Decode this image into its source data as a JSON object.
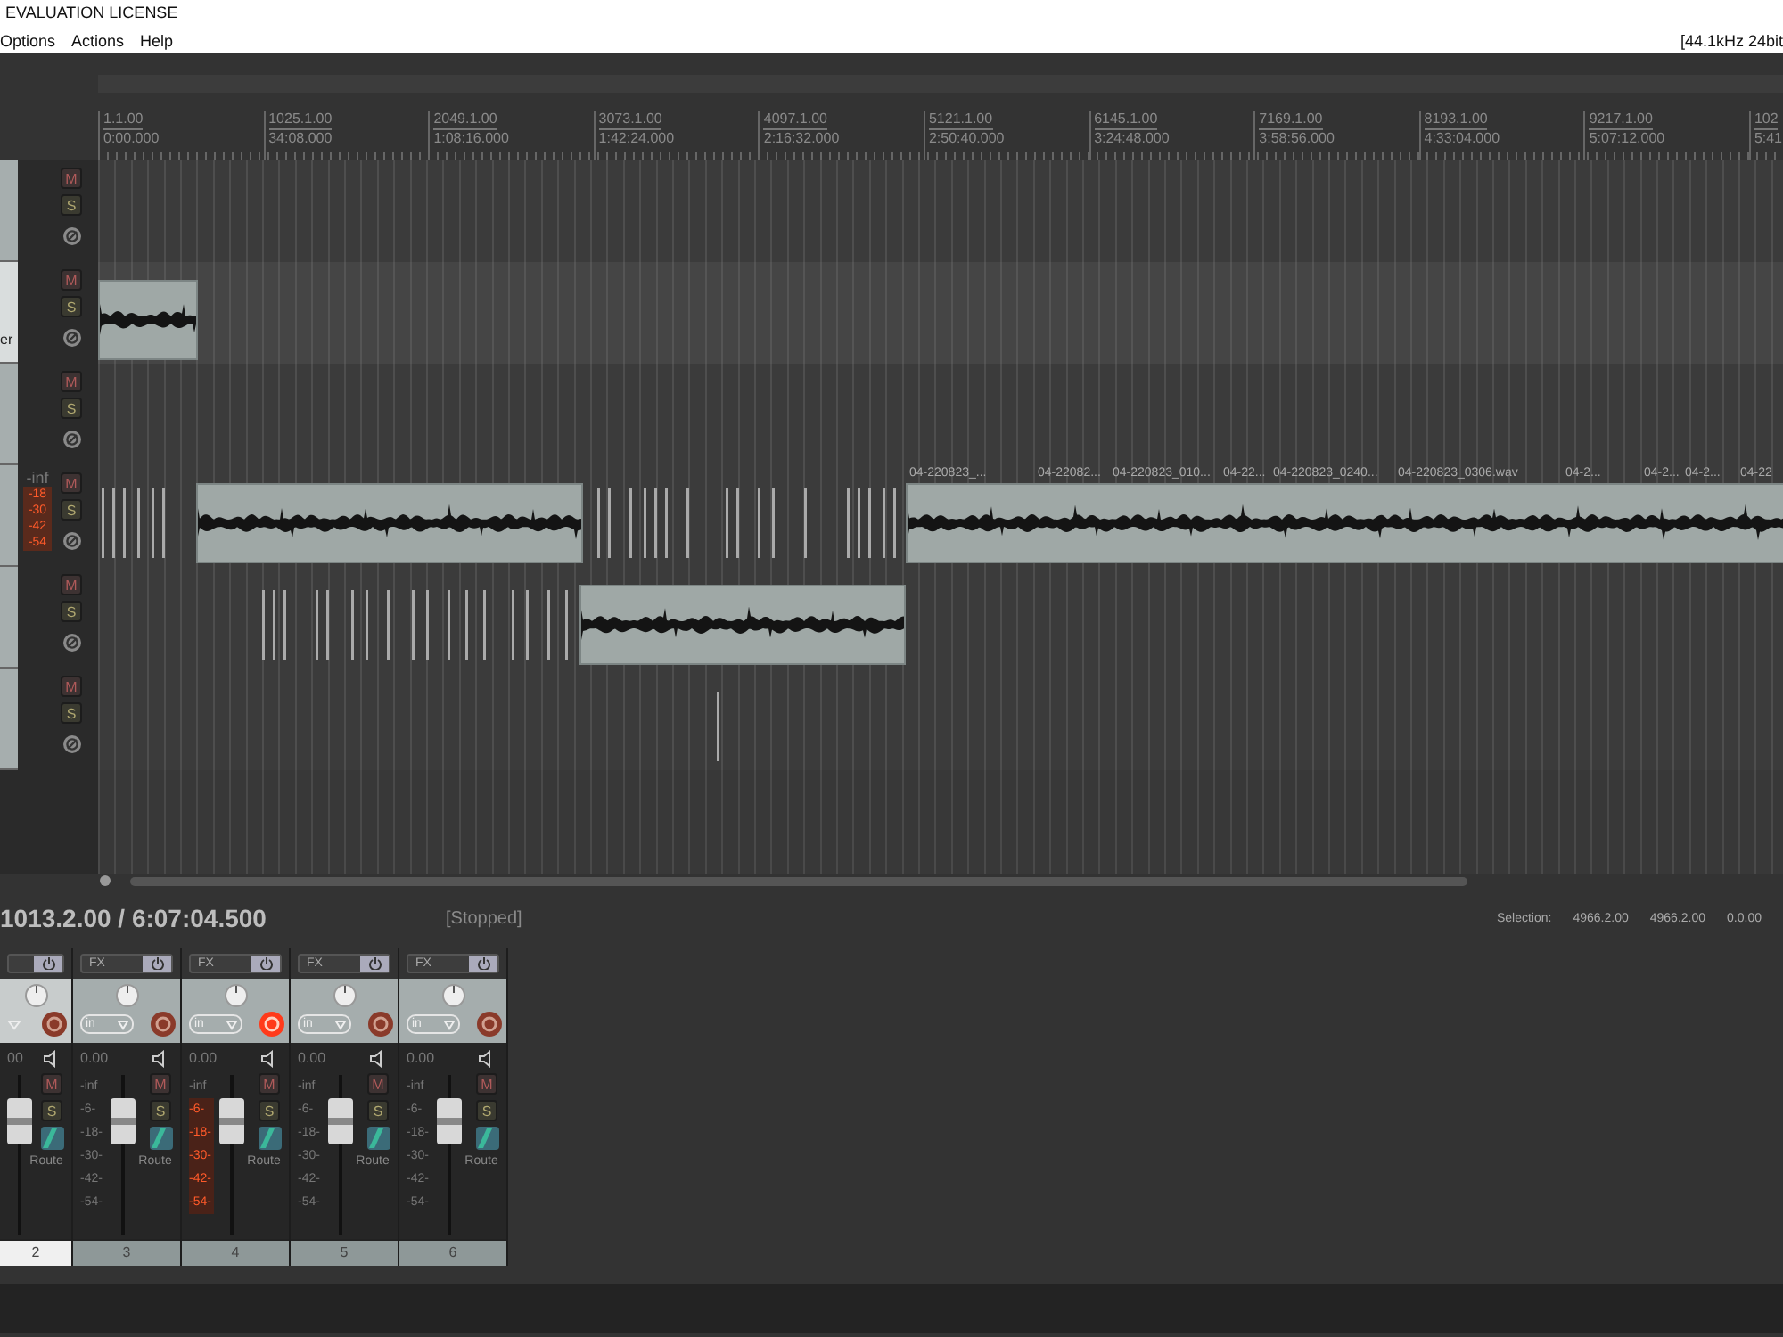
{
  "window": {
    "title": "EVALUATION LICENSE"
  },
  "menu": [
    "Options",
    "Actions",
    "Help"
  ],
  "status_format": "[44.1kHz 24bit",
  "ruler": [
    {
      "bar": "1.1.00",
      "time": "0:00.000"
    },
    {
      "bar": "1025.1.00",
      "time": "34:08.000"
    },
    {
      "bar": "2049.1.00",
      "time": "1:08:16.000"
    },
    {
      "bar": "3073.1.00",
      "time": "1:42:24.000"
    },
    {
      "bar": "4097.1.00",
      "time": "2:16:32.000"
    },
    {
      "bar": "5121.1.00",
      "time": "2:50:40.000"
    },
    {
      "bar": "6145.1.00",
      "time": "3:24:48.000"
    },
    {
      "bar": "7169.1.00",
      "time": "3:58:56.000"
    },
    {
      "bar": "8193.1.00",
      "time": "4:33:04.000"
    },
    {
      "bar": "9217.1.00",
      "time": "5:07:12.000"
    },
    {
      "bar": "102",
      "time": "5:41"
    }
  ],
  "tracks": [
    {
      "selected": false,
      "buttons": [
        "M",
        "S"
      ]
    },
    {
      "name": "er",
      "selected": true,
      "buttons": [
        "M",
        "S"
      ]
    },
    {
      "selected": false,
      "buttons": [
        "M",
        "S"
      ]
    },
    {
      "selected": false,
      "buttons": [
        "M",
        "S"
      ],
      "meter": {
        "top": "-inf",
        "marks": [
          "-18",
          "-30",
          "-42",
          "-54"
        ]
      },
      "clip_labels": [
        "04-220823_...",
        "04-22082...",
        "04-220823_010...",
        "04-22...",
        "04-220823_0240...",
        "04-220823_0306.wav",
        "04-2...",
        "04-2...",
        "04-2...",
        "04-22"
      ]
    },
    {
      "selected": false,
      "buttons": [
        "M",
        "S"
      ]
    },
    {
      "selected": false,
      "buttons": [
        "M",
        "S"
      ]
    }
  ],
  "transport": {
    "position": "1013.2.00 / 6:07:04.500",
    "state": "[Stopped]",
    "selection_label": "Selection:",
    "selection": [
      "4966.2.00",
      "4966.2.00",
      "0.0.00"
    ]
  },
  "mixer": [
    {
      "kind": "partial",
      "number": "2",
      "selected": true,
      "armed": false,
      "volume": "00",
      "buttons": [
        "M",
        "S"
      ],
      "route": "Route"
    },
    {
      "kind": "full",
      "number": "3",
      "selected": false,
      "armed": false,
      "fx": "FX",
      "input": "in",
      "volume": "0.00",
      "scale": [
        "-inf",
        "-6-",
        "-18-",
        "-30-",
        "-42-",
        "-54-"
      ],
      "buttons": [
        "M",
        "S"
      ],
      "route": "Route"
    },
    {
      "kind": "full",
      "number": "4",
      "selected": false,
      "armed": true,
      "fx": "FX",
      "input": "in",
      "volume": "0.00",
      "scale": [
        "-inf",
        "-6-",
        "-18-",
        "-30-",
        "-42-",
        "-54-"
      ],
      "buttons": [
        "M",
        "S"
      ],
      "route": "Route"
    },
    {
      "kind": "full",
      "number": "5",
      "selected": false,
      "armed": false,
      "fx": "FX",
      "input": "in",
      "volume": "0.00",
      "scale": [
        "-inf",
        "-6-",
        "-18-",
        "-30-",
        "-42-",
        "-54-"
      ],
      "buttons": [
        "M",
        "S"
      ],
      "route": "Route"
    },
    {
      "kind": "full",
      "number": "6",
      "selected": false,
      "armed": false,
      "fx": "FX",
      "input": "in",
      "volume": "0.00",
      "scale": [
        "-inf",
        "-6-",
        "-18-",
        "-30-",
        "-42-",
        "-54-"
      ],
      "buttons": [
        "M",
        "S"
      ],
      "route": "Route"
    }
  ]
}
